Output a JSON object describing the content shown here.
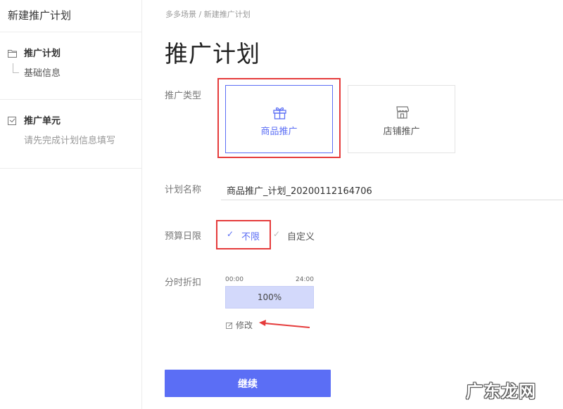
{
  "sidebar": {
    "title": "新建推广计划",
    "sections": [
      {
        "heading": "推广计划",
        "sub": "基础信息",
        "icon": "folder-icon"
      },
      {
        "heading": "推广单元",
        "sub": "请先完成计划信息填写",
        "icon": "checkbox-icon"
      }
    ]
  },
  "breadcrumb": "多多场景 / 新建推广计划",
  "page_title": "推广计划",
  "form": {
    "type_label": "推广类型",
    "types": [
      {
        "label": "商品推广",
        "icon": "gift-icon",
        "selected": true
      },
      {
        "label": "店铺推广",
        "icon": "store-icon",
        "selected": false
      }
    ],
    "name_label": "计划名称",
    "name_value": "商品推广_计划_20200112164706",
    "budget_label": "预算日限",
    "budget_options": [
      {
        "label": "不限",
        "selected": true
      },
      {
        "label": "自定义",
        "selected": false
      }
    ],
    "discount_label": "分时折扣",
    "time_start": "00:00",
    "time_end": "24:00",
    "discount_value": "100%",
    "edit_label": "修改"
  },
  "continue_label": "继续",
  "watermark": {
    "main": "广东龙网",
    "sub": ""
  },
  "colors": {
    "accent": "#5b6ef5",
    "highlight": "#e53b3b",
    "bar_fill": "#d3d9fb"
  }
}
